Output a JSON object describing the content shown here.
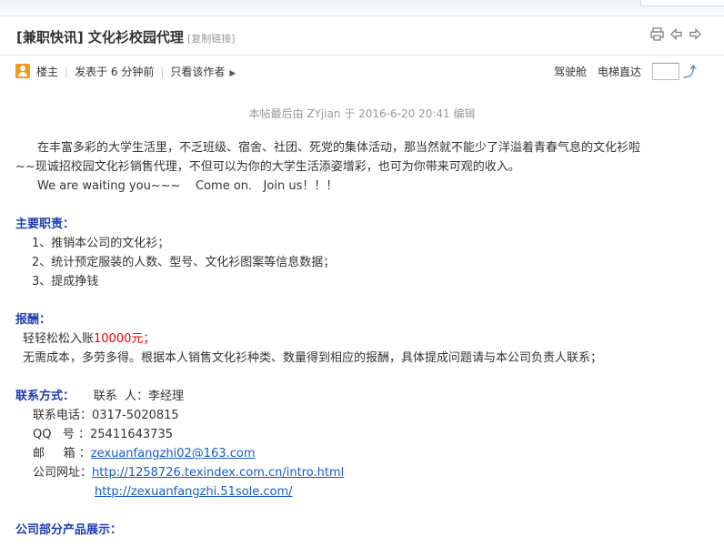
{
  "header": {
    "title": "[兼职快讯] 文化衫校园代理",
    "copy_link": "[复制链接]"
  },
  "author_bar": {
    "role": "楼主",
    "posted": "发表于 6 分钟前",
    "only_author": "只看该作者",
    "cockpit": "驾驶舱",
    "elevator": "电梯直达"
  },
  "edit_note": "本帖最后由 ZYjian 于 2016-6-20 20:41 编辑",
  "post": {
    "intro_1": "在丰富多彩的大学生活里，不乏班级、宿舍、社团、死党的集体活动，那当然就不能少了洋溢着青春气息的文化衫啦",
    "intro_2": "~~现诚招校园文化衫销售代理，不但可以为你的大学生活添姿增彩，也可为你带来可观的收入。",
    "intro_3": "We are waiting you~~~    Come on.   Join us！！！",
    "duties_title": "主要职责：",
    "duties": [
      "1、推销本公司的文化衫；",
      "2、统计预定服装的人数、型号、文化衫图案等信息数据；",
      "3、提成挣钱"
    ],
    "pay_title": "报酬：",
    "pay_line_prefix": "轻轻松松入账",
    "pay_amount": "10000元；",
    "pay_desc": "无需成本，多劳多得。根据本人销售文化衫种类、数量得到相应的报酬，具体提成问题请与本公司负责人联系；",
    "contact_title": "联系方式：",
    "contact_person_label": "联系  人：",
    "contact_person": "李经理",
    "phone_label": "联系电话：",
    "phone": "0317-5020815",
    "qq_label": "QQ   号 ：",
    "qq": "25411643735",
    "email_label": "邮     箱 ：",
    "email": "zexuanfangzhi02@163.com",
    "website_label": "公司网址：",
    "website_1": "http://1258726.texindex.com.cn/intro.html",
    "website_2": "http://zexuanfangzhi.51sole.com/",
    "products_title": "公司部分产品展示："
  },
  "colors": {
    "heading": "#1f3db6",
    "highlight": "#e60000",
    "link": "#1a5ac8",
    "avatar": "#f39a1b"
  },
  "icons": [
    "print-icon",
    "prev-thread-icon",
    "next-thread-icon",
    "user-avatar-icon",
    "go-icon"
  ]
}
